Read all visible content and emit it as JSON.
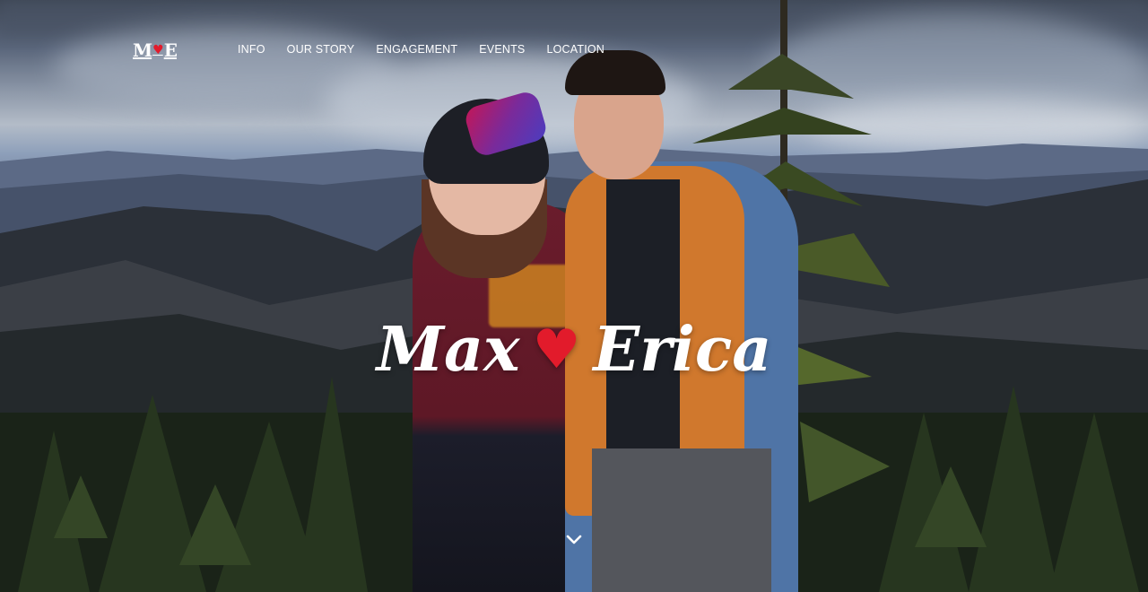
{
  "brand": {
    "left": "M",
    "heart": "♥",
    "right": "E"
  },
  "nav": {
    "items": [
      {
        "label": "INFO"
      },
      {
        "label": "OUR STORY"
      },
      {
        "label": "ENGAGEMENT"
      },
      {
        "label": "EVENTS"
      },
      {
        "label": "LOCATION"
      }
    ]
  },
  "hero": {
    "name_left": "Max",
    "heart": "♥",
    "name_right": "Erica",
    "scroll_icon": "chevron-down-icon"
  },
  "colors": {
    "accent_heart": "#e21b2b",
    "text": "#ffffff"
  }
}
